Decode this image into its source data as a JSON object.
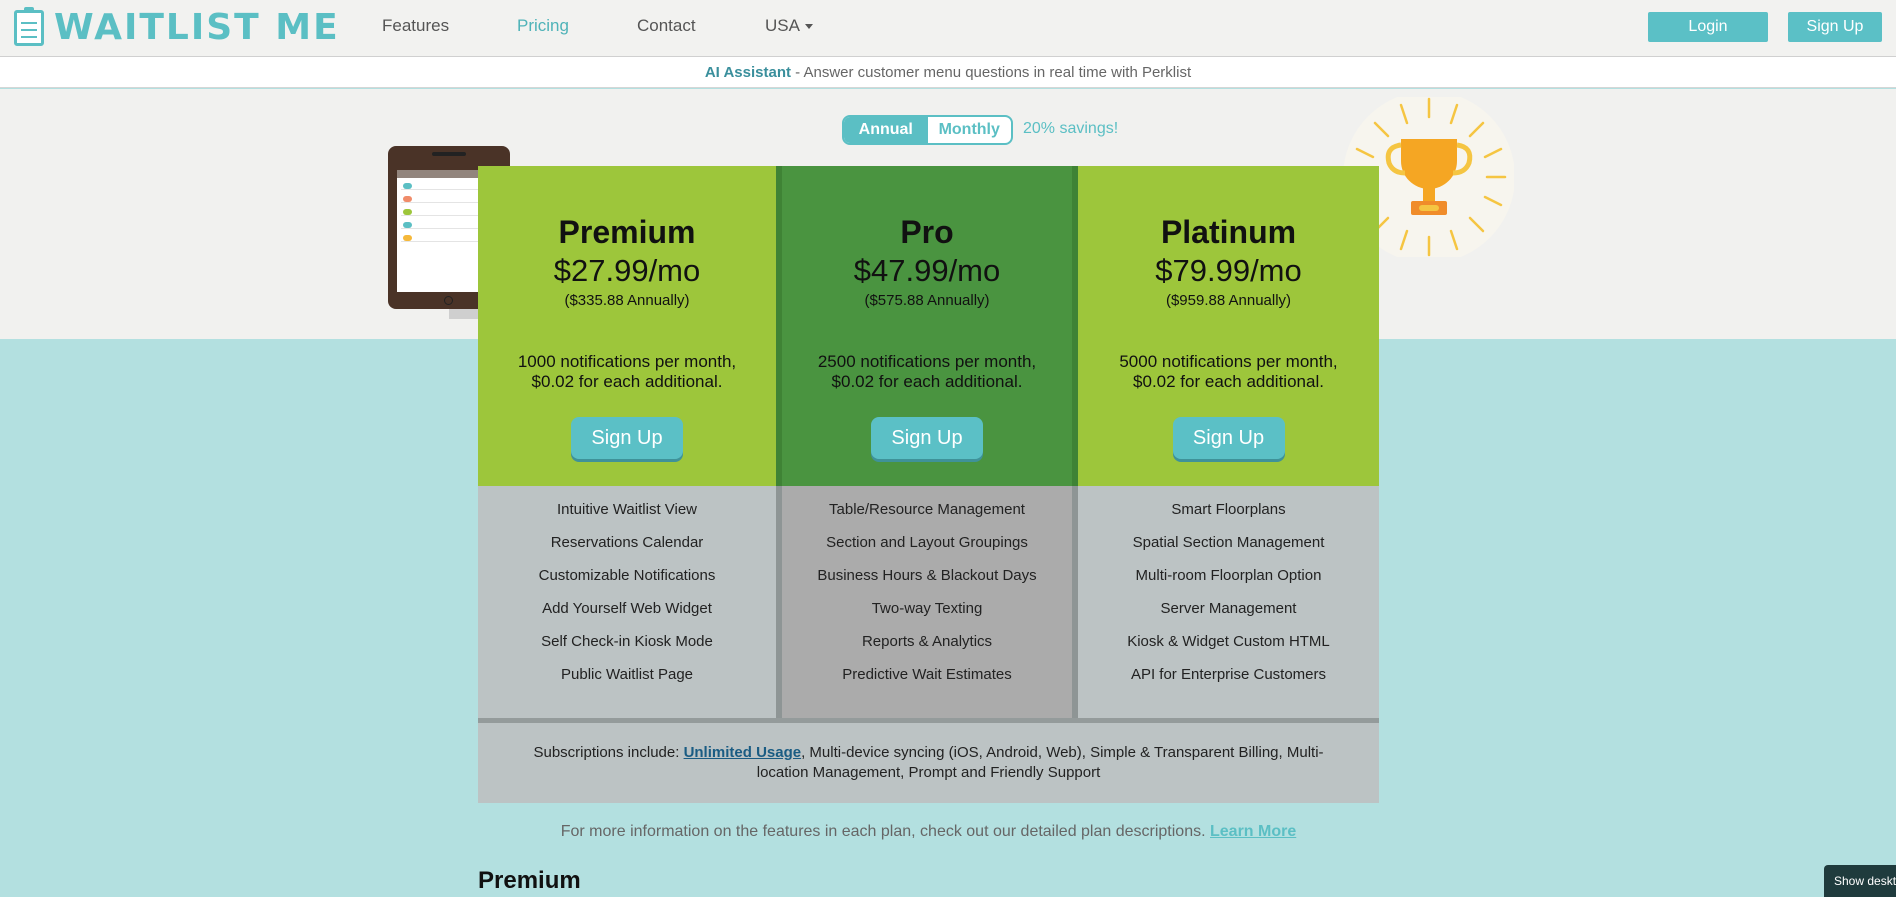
{
  "brand": {
    "name": "WAITLIST ME",
    "accent": "#5bbfc4"
  },
  "nav": {
    "features": "Features",
    "pricing": "Pricing",
    "contact": "Contact",
    "region": "USA",
    "login": "Login",
    "signup": "Sign Up"
  },
  "announcement": {
    "highlight": "AI Assistant",
    "text": " - Answer customer menu questions in real time with Perklist"
  },
  "billing": {
    "annual": "Annual",
    "monthly": "Monthly",
    "selected": "Annual",
    "savings": "20% savings!"
  },
  "plans": [
    {
      "name": "Premium",
      "price": "$27.99/mo",
      "annual": "($335.88 Annually)",
      "notif_line1": "1000 notifications per month,",
      "notif_line2": "$0.02 for each additional.",
      "button": "Sign Up",
      "color": "#9dc63b",
      "features": [
        "Intuitive Waitlist View",
        "Reservations Calendar",
        "Customizable Notifications",
        "Add Yourself Web Widget",
        "Self Check-in Kiosk Mode",
        "Public Waitlist Page"
      ]
    },
    {
      "name": "Pro",
      "price": "$47.99/mo",
      "annual": "($575.88 Annually)",
      "notif_line1": "2500 notifications per month,",
      "notif_line2": "$0.02 for each additional.",
      "button": "Sign Up",
      "color": "#4a9440",
      "features": [
        "Table/Resource Management",
        "Section and Layout Groupings",
        "Business Hours & Blackout Days",
        "Two-way Texting",
        "Reports & Analytics",
        "Predictive Wait Estimates"
      ]
    },
    {
      "name": "Platinum",
      "price": "$79.99/mo",
      "annual": "($959.88 Annually)",
      "notif_line1": "5000 notifications per month,",
      "notif_line2": "$0.02 for each additional.",
      "button": "Sign Up",
      "color": "#9dc63b",
      "features": [
        "Smart Floorplans",
        "Spatial Section Management",
        "Multi-room Floorplan Option",
        "Server Management",
        "Kiosk & Widget Custom HTML",
        "API for Enterprise Customers"
      ]
    }
  ],
  "subscriptions": {
    "prefix": "Subscriptions include: ",
    "link": "Unlimited Usage",
    "rest": ", Multi-device syncing (iOS, Android, Web), Simple & Transparent Billing, Multi-location Management, Prompt and Friendly Support"
  },
  "more_info": {
    "text": "For more information on the features in each plan, check out our detailed plan descriptions. ",
    "link": "Learn More"
  },
  "section_title": "Premium",
  "show_desktop": "Show deskt"
}
